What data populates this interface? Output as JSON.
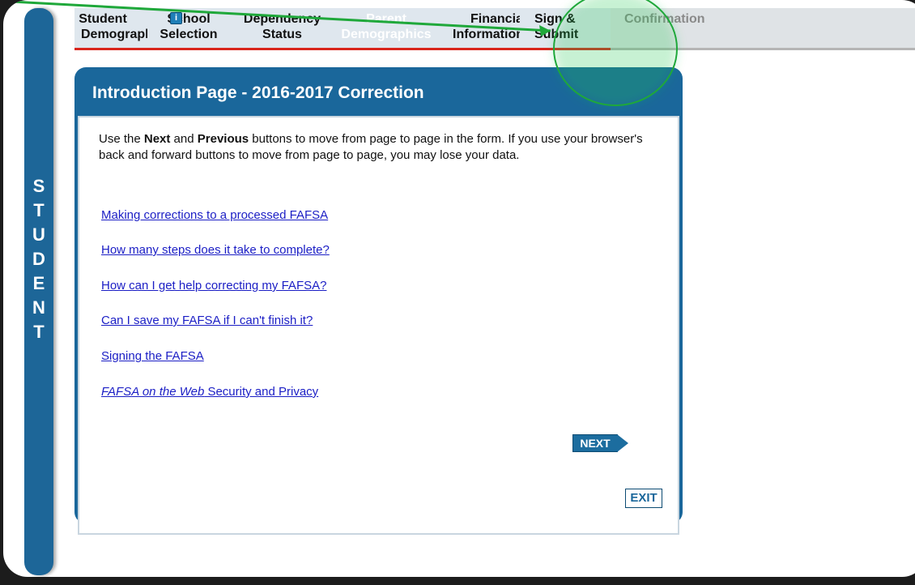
{
  "sidebar": {
    "label_letters": "STUDENT"
  },
  "tabs": [
    {
      "line1": "Student",
      "line2": "Demographics",
      "state": "completed"
    },
    {
      "line1": "School",
      "line2": "Selection",
      "state": "completed"
    },
    {
      "line1": "Dependency",
      "line2": "Status",
      "state": "completed"
    },
    {
      "line1": "Parent",
      "line2": "Demographics",
      "state": "disabled"
    },
    {
      "line1": "Financial",
      "line2": "Information",
      "state": "completed"
    },
    {
      "line1": "Sign &",
      "line2": "Submit",
      "state": "completed"
    },
    {
      "line1": "Confirmation",
      "line2": "",
      "state": "inactive"
    }
  ],
  "info_icon_label": "i",
  "panel": {
    "title": "Introduction Page - 2016-2017 Correction",
    "intro_prefix": "Use the ",
    "intro_next": "Next",
    "intro_and": " and ",
    "intro_previous": "Previous",
    "intro_suffix": " buttons to move from page to page in the form. If you use your browser's back and forward buttons to move from page to page, you may lose your data.",
    "links": [
      "Making corrections to a processed FAFSA",
      "How many steps does it take to complete?",
      "How can I get help correcting my FAFSA?",
      "Can I save my FAFSA if I can't finish it?",
      "Signing the FAFSA"
    ],
    "security_link_italic": "FAFSA on the Web",
    "security_link_rest": " Security and Privacy",
    "next_label": "NEXT",
    "exit_label": "EXIT"
  },
  "colors": {
    "panel_blue": "#1a679b",
    "tab_underline": "#d9251c",
    "link": "#1b1ec5",
    "annotation_green": "#1fa83a"
  }
}
